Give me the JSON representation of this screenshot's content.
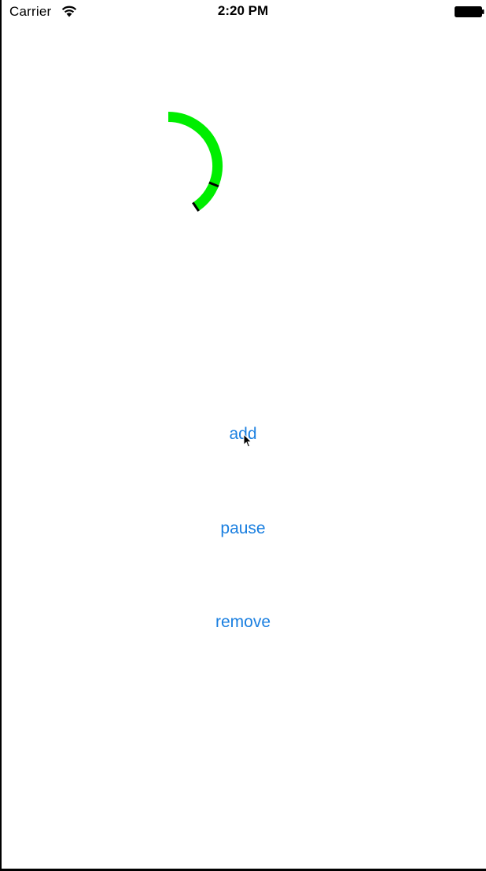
{
  "status_bar": {
    "carrier": "Carrier",
    "time": "2:20 PM"
  },
  "progress_ring": {
    "color": "#00ee00",
    "tick_color": "#000000",
    "start_angle_deg": 0,
    "end_angle_deg": 146,
    "marker_angle_deg": 112
  },
  "buttons": {
    "add_label": "add",
    "pause_label": "pause",
    "remove_label": "remove",
    "color": "#1a7fe0"
  },
  "icons": {
    "wifi": "wifi-icon",
    "battery": "battery-icon",
    "cursor": "mouse-pointer-icon"
  }
}
